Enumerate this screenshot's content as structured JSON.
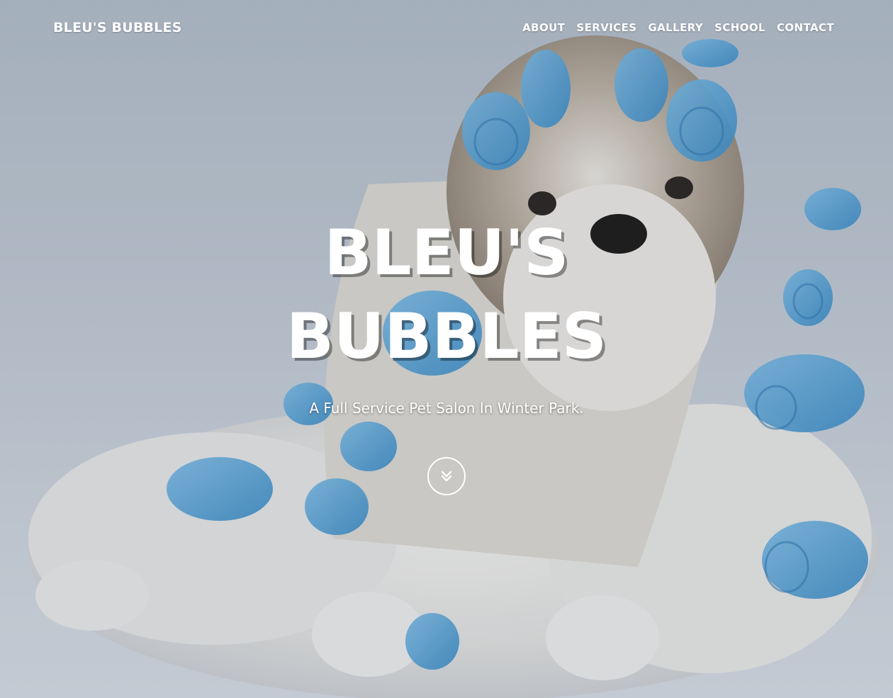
{
  "navbar": {
    "brand": "BLEU'S BUBBLES",
    "links": [
      "ABOUT",
      "SERVICES",
      "GALLERY",
      "SCHOOL",
      "CONTACT"
    ]
  },
  "hero": {
    "title_line1": "BLEU'S",
    "title_line2": "BUBBLES",
    "subtitle": "A Full Service Pet Salon In Winter Park.",
    "scroll_icon": "double-chevron-down-icon"
  },
  "colors": {
    "text": "#ffffff",
    "background": "#c1c9d3",
    "curler_blue": "#4f9fd4"
  }
}
